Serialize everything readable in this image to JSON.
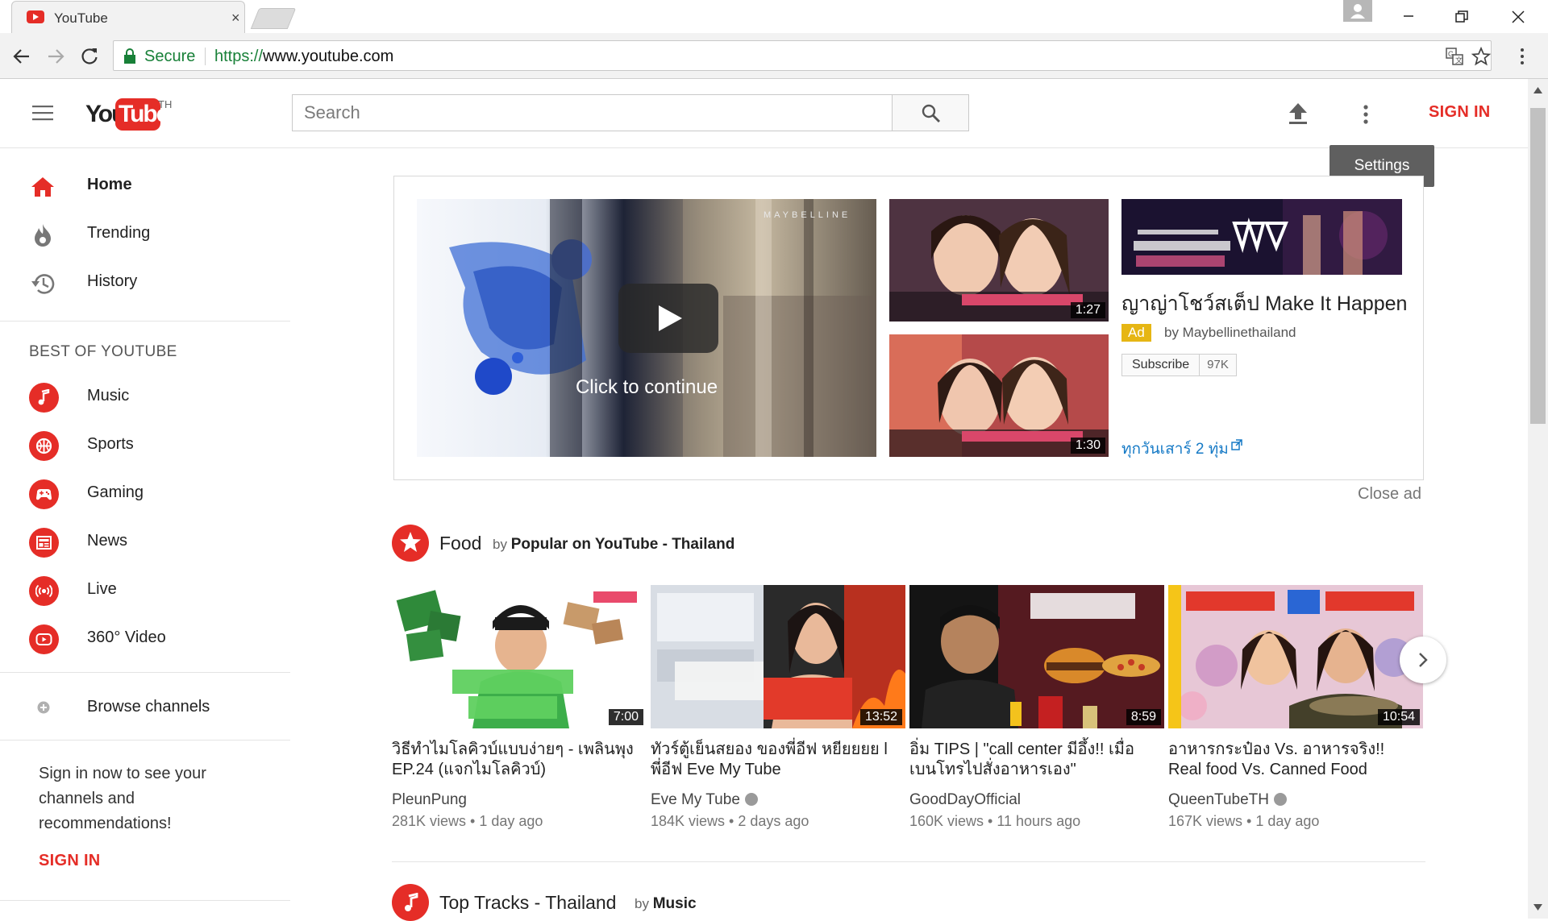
{
  "browser": {
    "tab_title": "YouTube",
    "tab_close": "×",
    "secure_label": "Secure",
    "url_scheme": "https://",
    "url_rest": "www.youtube.com"
  },
  "masthead": {
    "logo_you": "You",
    "logo_tube": "Tube",
    "region": "TH",
    "search_placeholder": "Search",
    "sign_in": "SIGN IN",
    "tooltip": "Settings"
  },
  "sidebar": {
    "main_items": [
      {
        "label": "Home",
        "icon": "home-icon"
      },
      {
        "label": "Trending",
        "icon": "flame-icon"
      },
      {
        "label": "History",
        "icon": "history-icon"
      }
    ],
    "best_title": "BEST OF YOUTUBE",
    "categories": [
      {
        "label": "Music",
        "icon": "music-note-icon"
      },
      {
        "label": "Sports",
        "icon": "sports-ball-icon"
      },
      {
        "label": "Gaming",
        "icon": "gamepad-icon"
      },
      {
        "label": "News",
        "icon": "newspaper-icon"
      },
      {
        "label": "Live",
        "icon": "live-broadcast-icon"
      },
      {
        "label": "360° Video",
        "icon": "360-video-icon"
      }
    ],
    "browse_channels": "Browse channels",
    "signin_prompt": "Sign in now to see your channels and recommendations!",
    "sign_in": "SIGN IN"
  },
  "ad": {
    "click_to_continue": "Click to continue",
    "brand_watermark": "MAYBELLINE",
    "thumb1_duration": "1:27",
    "thumb2_duration": "1:30",
    "title": "ญาญ่าโชว์สเต็ป Make It Happen",
    "badge": "Ad",
    "by": "by Maybellinethailand",
    "subscribe": "Subscribe",
    "subscriber_count": "97K",
    "link": "ทุกวันเสาร์ 2 ทุ่ม",
    "close": "Close ad"
  },
  "shelves": [
    {
      "title": "Food",
      "by_prefix": "by",
      "by_name": "Popular on YouTube - Thailand",
      "icon": "star-icon",
      "videos": [
        {
          "title": "วิธีทำไมโลคิวบ์แบบง่ายๆ - เพลินพุง EP.24 (แจกไมโลคิวบ์)",
          "channel": "PleunPung",
          "verified": false,
          "meta": "281K views • 1 day ago",
          "duration": "7:00"
        },
        {
          "title": "ทัวร์ตู้เย็นสยอง ของพี่อีฟ หยียยยย l พี่อีฟ Eve My Tube",
          "channel": "Eve My Tube",
          "verified": true,
          "meta": "184K views • 2 days ago",
          "duration": "13:52"
        },
        {
          "title": "อิ่ม TIPS | \"call center มีอึ้ง!! เมื่อเบนโทรไปสั่งอาหารเอง\"",
          "channel": "GoodDayOfficial",
          "verified": false,
          "meta": "160K views • 11 hours ago",
          "duration": "8:59"
        },
        {
          "title": "อาหารกระป๋อง Vs. อาหารจริง!! Real food Vs. Canned Food",
          "channel": "QueenTubeTH",
          "verified": true,
          "meta": "167K views • 1 day ago",
          "duration": "10:54"
        }
      ]
    },
    {
      "title": "Top Tracks - Thailand",
      "by_prefix": "by",
      "by_name": "Music",
      "icon": "music-note-icon"
    }
  ],
  "colors": {
    "brand_red": "#e52d27",
    "link_blue": "#167ac6",
    "ad_badge": "#e6b614",
    "secure_green": "#188038"
  }
}
